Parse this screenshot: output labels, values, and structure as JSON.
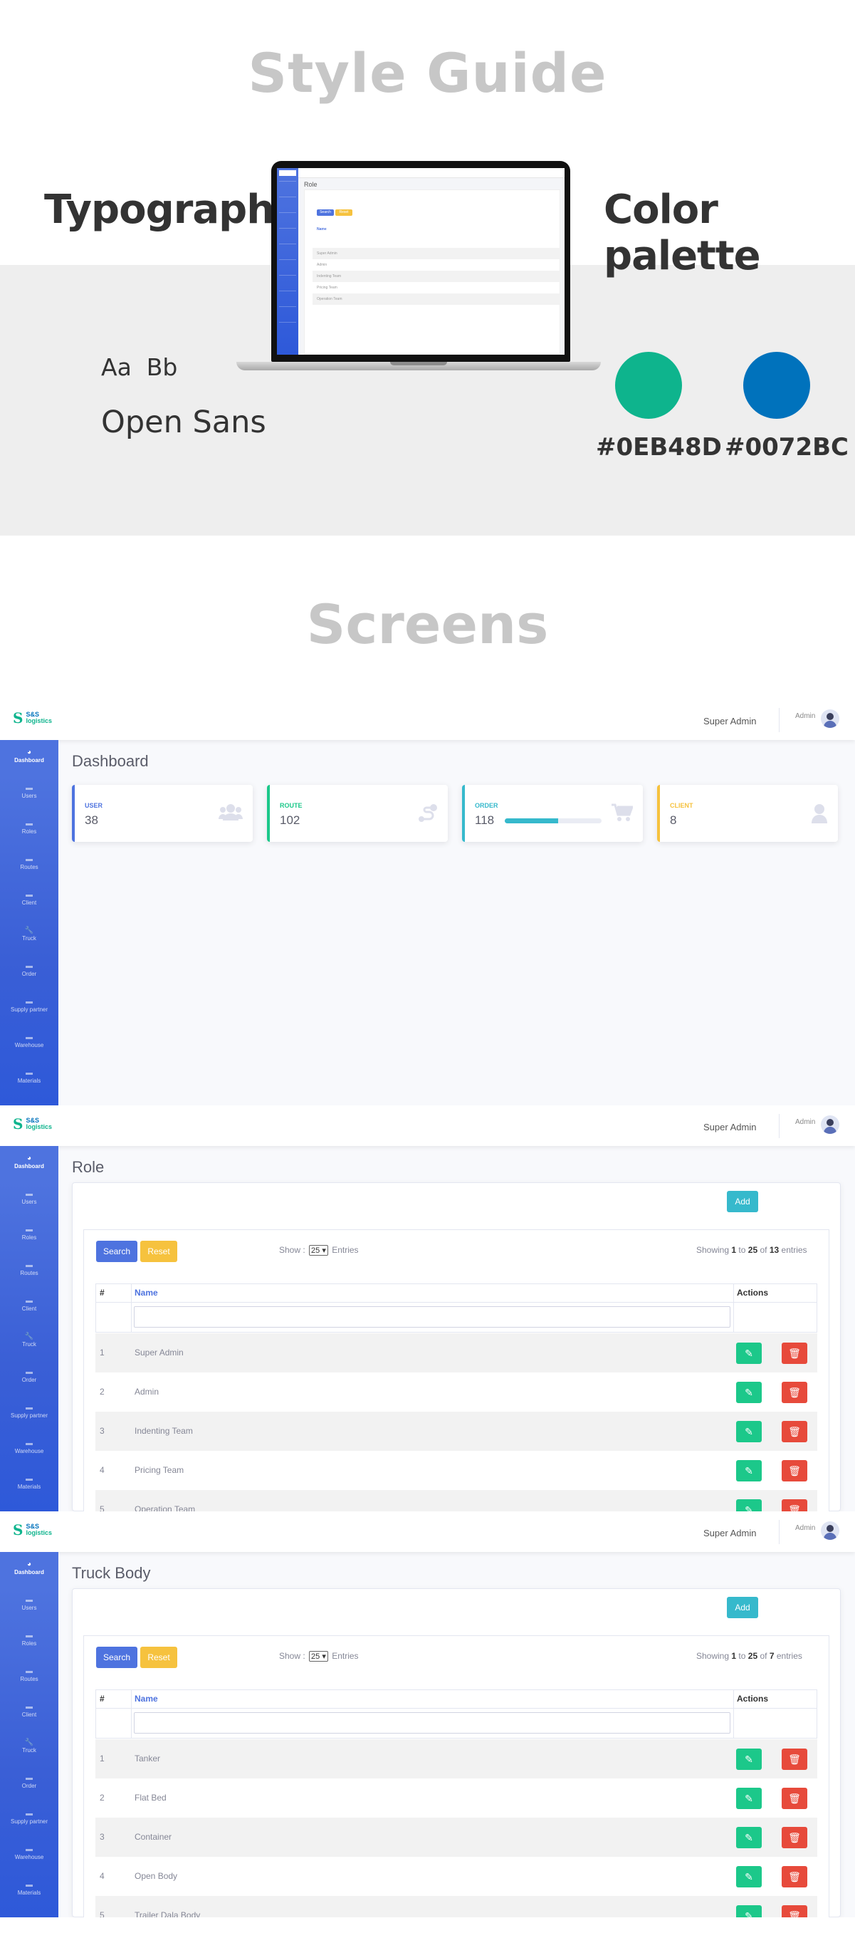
{
  "style_guide": {
    "title": "Style Guide",
    "typography_heading": "Typography",
    "color_heading": "Color palette",
    "sample_letters": "Aa  Bb",
    "font_name": "Open Sans",
    "colors": [
      {
        "hex": "#0EB48D",
        "label": "#0EB48D"
      },
      {
        "hex": "#0072BC",
        "label": "#0072BC"
      }
    ],
    "screens_title": "Screens"
  },
  "brand": {
    "mark": "S",
    "line1": "S&S",
    "line2": "logistics"
  },
  "topbar": {
    "user_name": "Super Admin",
    "role": "Admin"
  },
  "sidebar": [
    {
      "label": "Dashboard",
      "icon": "speedometer-icon"
    },
    {
      "label": "Users",
      "icon": "folder-icon"
    },
    {
      "label": "Roles",
      "icon": "folder-icon"
    },
    {
      "label": "Routes",
      "icon": "folder-icon"
    },
    {
      "label": "Client",
      "icon": "folder-icon"
    },
    {
      "label": "Truck",
      "icon": "wrench-icon"
    },
    {
      "label": "Order",
      "icon": "folder-icon"
    },
    {
      "label": "Supply partner",
      "icon": "folder-icon"
    },
    {
      "label": "Warehouse",
      "icon": "folder-icon"
    },
    {
      "label": "Materials",
      "icon": "folder-icon"
    }
  ],
  "dashboard": {
    "title": "Dashboard",
    "cards": [
      {
        "label": "USER",
        "value": "38",
        "color": "#4e73df",
        "icon": "users-icon"
      },
      {
        "label": "ROUTE",
        "value": "102",
        "color": "#1cc88a",
        "icon": "route-icon"
      },
      {
        "label": "ORDER",
        "value": "118",
        "color": "#36b9cc",
        "icon": "cart-icon",
        "progress": 0.55
      },
      {
        "label": "CLIENT",
        "value": "8",
        "color": "#f6c23e",
        "icon": "user-icon"
      }
    ]
  },
  "role_screen": {
    "title": "Role",
    "add_label": "Add",
    "search_label": "Search",
    "reset_label": "Reset",
    "show_prefix": "Show :",
    "show_value": "25",
    "show_suffix": "Entries",
    "showing_prefix": "Showing",
    "showing_from": "1",
    "showing_to_word": "to",
    "showing_to": "25",
    "showing_of_word": "of",
    "showing_total": "13",
    "showing_suffix": "entries",
    "columns": [
      "#",
      "Name",
      "Actions"
    ],
    "rows": [
      {
        "num": "1",
        "name": "Super Admin"
      },
      {
        "num": "2",
        "name": "Admin"
      },
      {
        "num": "3",
        "name": "Indenting Team"
      },
      {
        "num": "4",
        "name": "Pricing Team"
      },
      {
        "num": "5",
        "name": "Operation Team"
      }
    ]
  },
  "truck_screen": {
    "title": "Truck Body",
    "add_label": "Add",
    "search_label": "Search",
    "reset_label": "Reset",
    "show_prefix": "Show :",
    "show_value": "25",
    "show_suffix": "Entries",
    "showing_prefix": "Showing",
    "showing_from": "1",
    "showing_to_word": "to",
    "showing_to": "25",
    "showing_of_word": "of",
    "showing_total": "7",
    "showing_suffix": "entries",
    "columns": [
      "#",
      "Name",
      "Actions"
    ],
    "rows": [
      {
        "num": "1",
        "name": "Tanker"
      },
      {
        "num": "2",
        "name": "Flat Bed"
      },
      {
        "num": "3",
        "name": "Container"
      },
      {
        "num": "4",
        "name": "Open Body"
      },
      {
        "num": "5",
        "name": "Trailer Dala Body"
      }
    ]
  },
  "mockup": {
    "title": "Role",
    "search": "Search",
    "reset": "Reset",
    "col": "Name",
    "rows": [
      "Super Admin",
      "Admin",
      "Indenting Team",
      "Pricing Team",
      "Operation Team"
    ]
  }
}
